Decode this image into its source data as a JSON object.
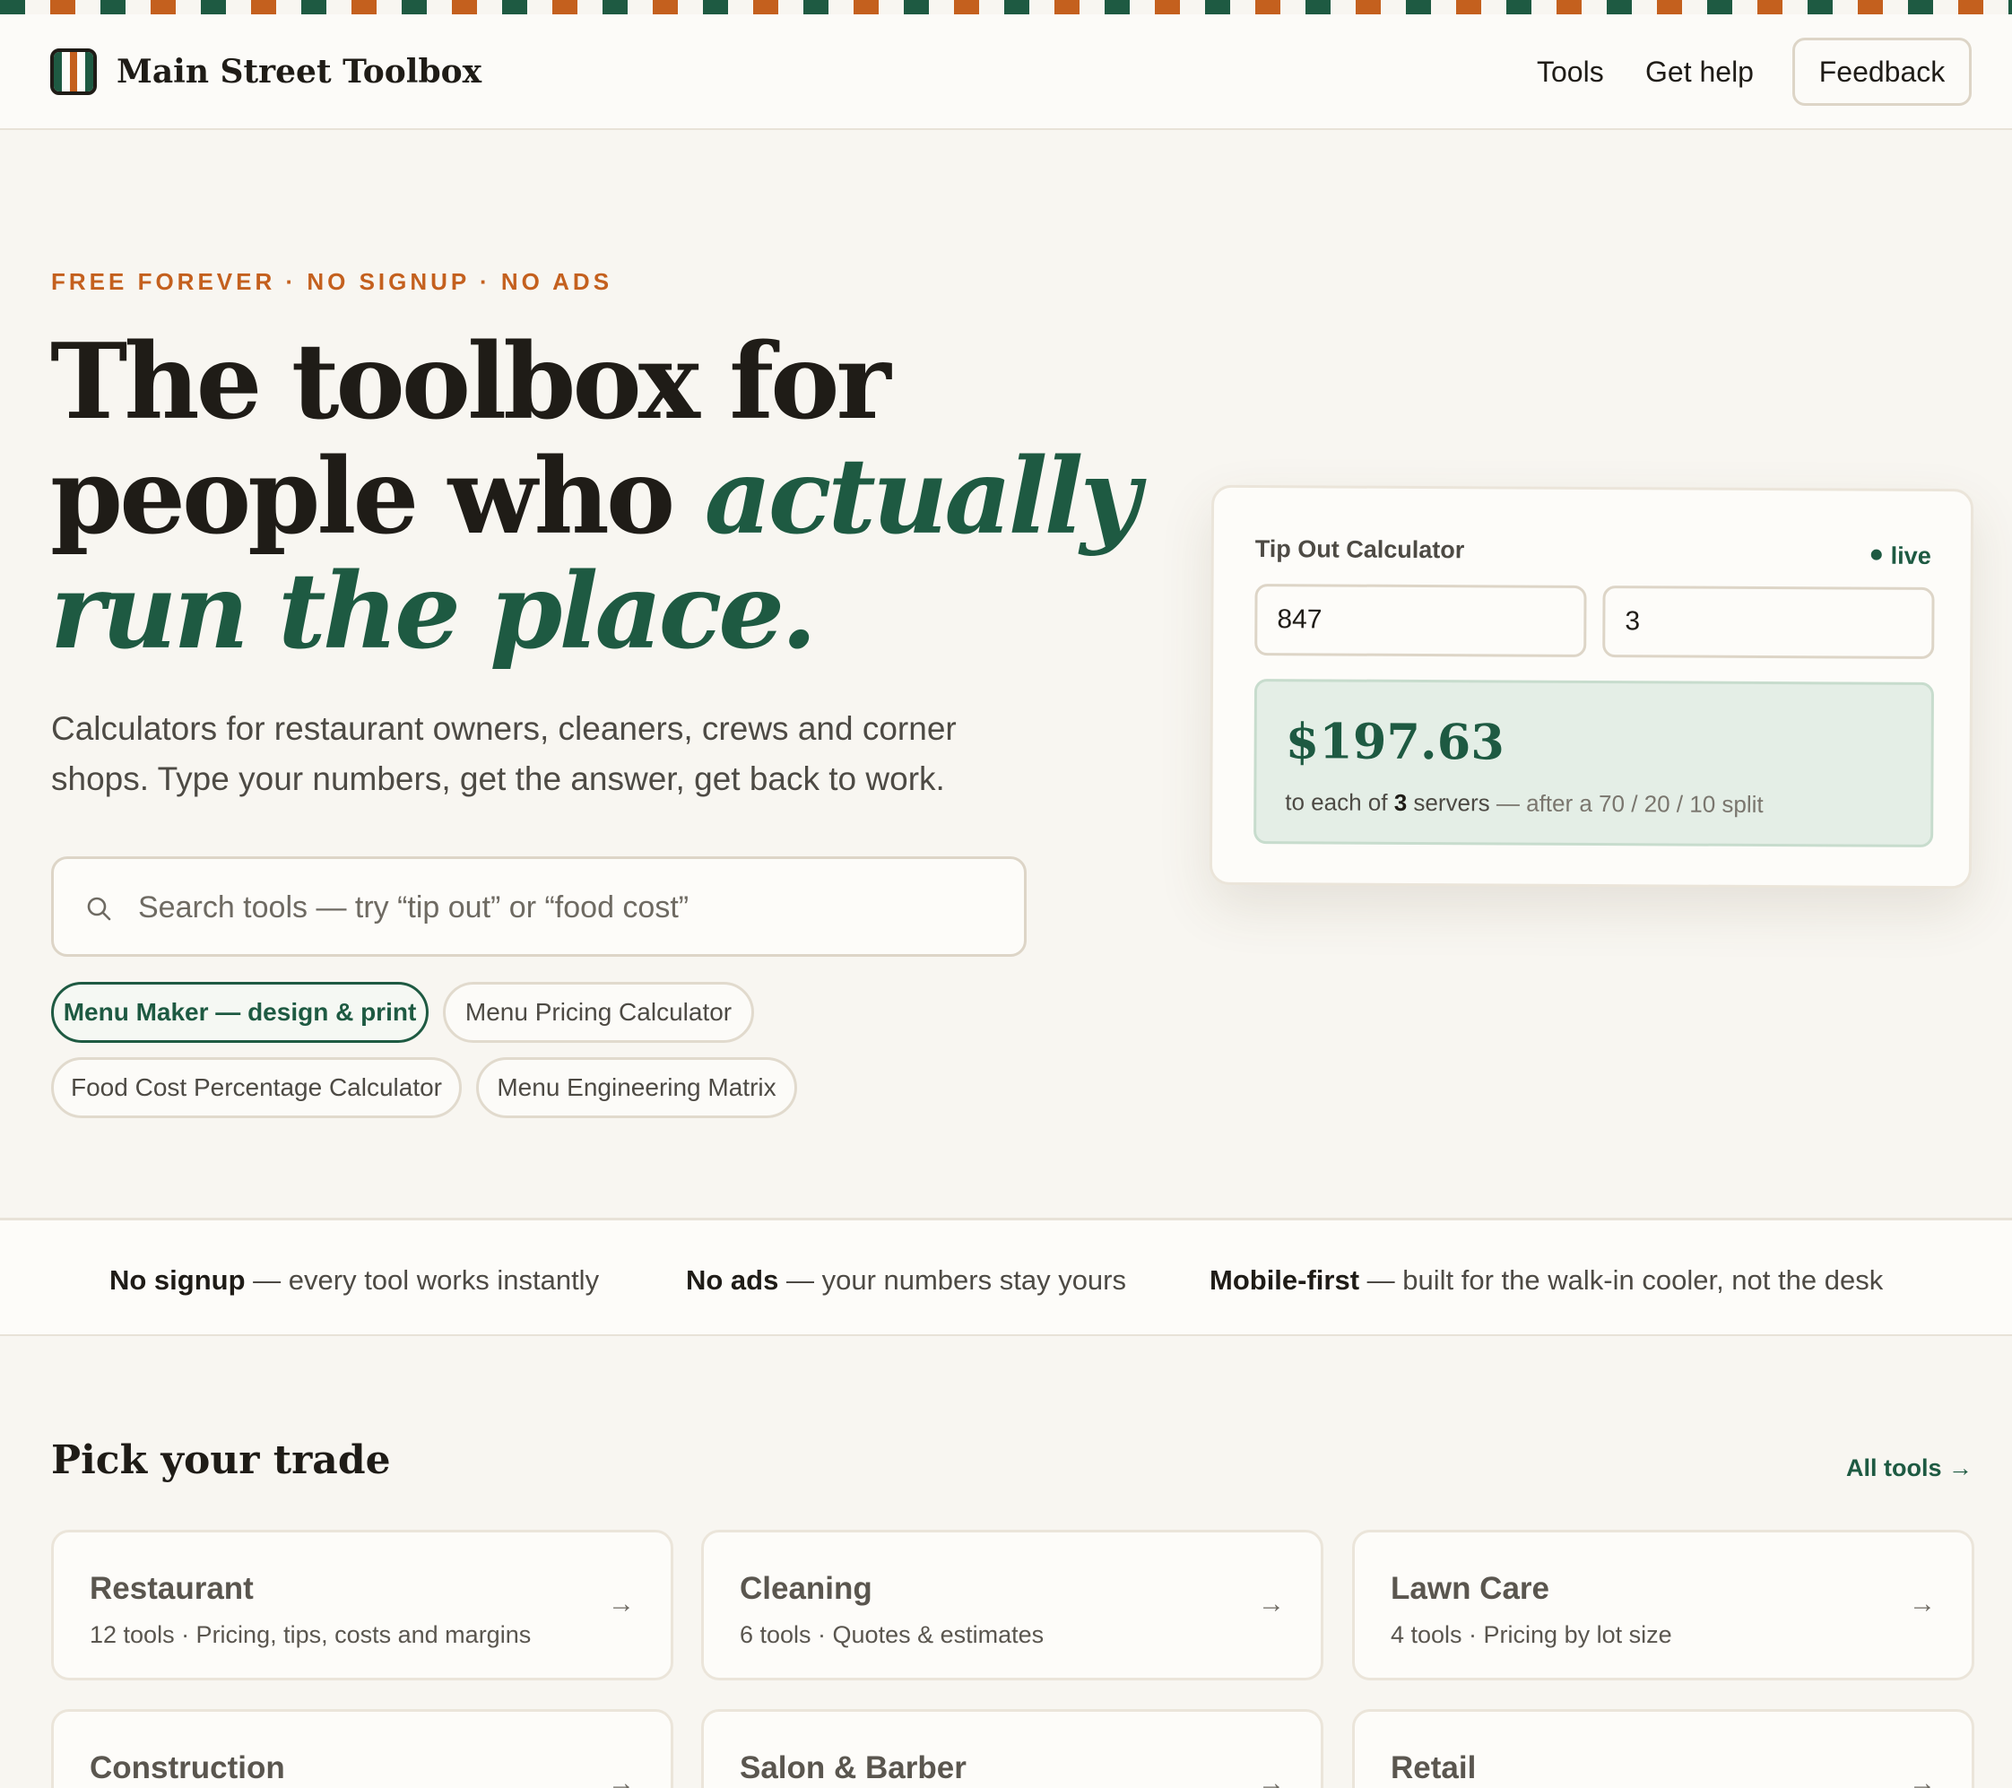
{
  "brand": {
    "name": "Main Street Toolbox",
    "logo_stripes": [
      "#1e5a42",
      "#fcfbf8",
      "#c4601e",
      "#fcfbf8",
      "#1e5a42"
    ]
  },
  "colors": {
    "accent_green": "#1e5a42",
    "accent_orange": "#c4601e",
    "background": "#f8f6f1"
  },
  "nav": {
    "tools": "Tools",
    "help": "Get help",
    "feedback": "Feedback"
  },
  "hero": {
    "eyebrow": "FREE FOREVER · NO SIGNUP · NO ADS",
    "title_plain": "The toolbox for people who ",
    "title_emphasis": "actually run the place.",
    "subtitle": "Calculators for restaurant owners, cleaners, crews and corner shops. Type your numbers, get the answer, get back to work.",
    "search_placeholder": "Search tools — try “tip out” or “food cost”",
    "search_icon": "search-icon",
    "chips": [
      "Menu Maker — design & print",
      "Menu Pricing Calculator",
      "Food Cost Percentage Calculator",
      "Menu Engineering Matrix"
    ]
  },
  "calculator": {
    "title": "Tip Out Calculator",
    "live_label": "live",
    "input_total": "847",
    "input_servers": "3",
    "result_amount": "$197.63",
    "result_prefix": "to each of",
    "result_count": "3",
    "result_unit": "servers",
    "result_detail": "— after a 70 / 20 / 10 split"
  },
  "features": [
    {
      "bold": "No signup",
      "text": " — every tool works instantly"
    },
    {
      "bold": "No ads",
      "text": " — your numbers stay yours"
    },
    {
      "bold": "Mobile-first",
      "text": " — built for the walk-in cooler, not the desk"
    }
  ],
  "trades": {
    "title": "Pick your trade",
    "all_link": "All tools →",
    "arrow": "→",
    "items": [
      {
        "name": "Restaurant",
        "meta": "12 tools · Pricing, tips, costs and margins"
      },
      {
        "name": "Cleaning",
        "meta": "6 tools · Quotes & estimates"
      },
      {
        "name": "Lawn Care",
        "meta": "4 tools · Pricing by lot size"
      },
      {
        "name": "Construction",
        "meta": ""
      },
      {
        "name": "Salon & Barber",
        "meta": ""
      },
      {
        "name": "Retail",
        "meta": ""
      }
    ]
  }
}
